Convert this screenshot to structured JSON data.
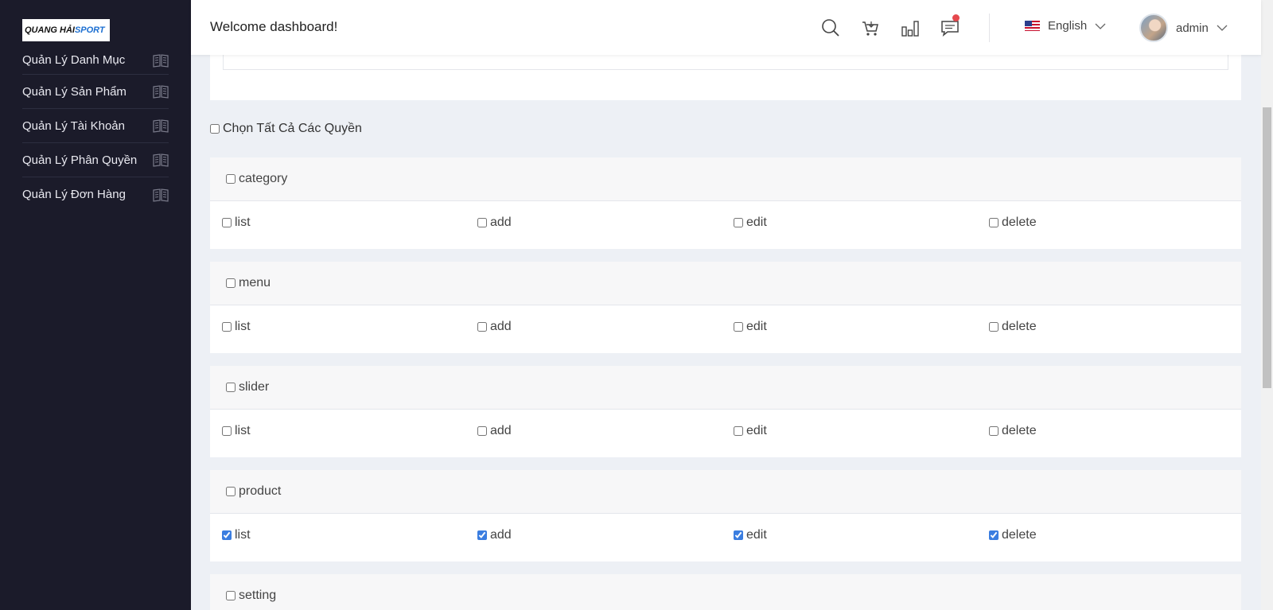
{
  "logo": {
    "part1": "QUANG HẢI ",
    "part2": "SPORT"
  },
  "sidebar": {
    "items": [
      {
        "label": "Quản Lý Danh Mục",
        "icon": "book-icon"
      },
      {
        "label": "Quản Lý Sản Phẩm",
        "icon": "book-icon"
      },
      {
        "label": "Quản Lý Tài Khoản",
        "icon": "book-icon"
      },
      {
        "label": "Quản Lý Phân Quyền",
        "icon": "book-icon"
      },
      {
        "label": "Quản Lý Đơn Hàng",
        "icon": "book-icon"
      }
    ]
  },
  "header": {
    "title": "Welcome dashboard!",
    "icons": [
      "search-icon",
      "cart-icon",
      "chart-icon",
      "message-icon"
    ],
    "language": "English",
    "user": "admin"
  },
  "permissions": {
    "select_all_label": "Chọn Tất Cả Các Quyền",
    "groups": [
      {
        "name": "category",
        "checked": false,
        "actions": [
          {
            "label": "list",
            "checked": false
          },
          {
            "label": "add",
            "checked": false
          },
          {
            "label": "edit",
            "checked": false
          },
          {
            "label": "delete",
            "checked": false
          }
        ]
      },
      {
        "name": "menu",
        "checked": false,
        "actions": [
          {
            "label": "list",
            "checked": false
          },
          {
            "label": "add",
            "checked": false
          },
          {
            "label": "edit",
            "checked": false
          },
          {
            "label": "delete",
            "checked": false
          }
        ]
      },
      {
        "name": "slider",
        "checked": false,
        "actions": [
          {
            "label": "list",
            "checked": false
          },
          {
            "label": "add",
            "checked": false
          },
          {
            "label": "edit",
            "checked": false
          },
          {
            "label": "delete",
            "checked": false
          }
        ]
      },
      {
        "name": "product",
        "checked": false,
        "actions": [
          {
            "label": "list",
            "checked": true
          },
          {
            "label": "add",
            "checked": true
          },
          {
            "label": "edit",
            "checked": true
          },
          {
            "label": "delete",
            "checked": true
          }
        ]
      },
      {
        "name": "setting",
        "checked": false,
        "actions": []
      }
    ]
  },
  "colors": {
    "sidebar_bg": "#1b1b2a",
    "accent": "#3a7de0",
    "page_bg": "#edf0f5"
  }
}
